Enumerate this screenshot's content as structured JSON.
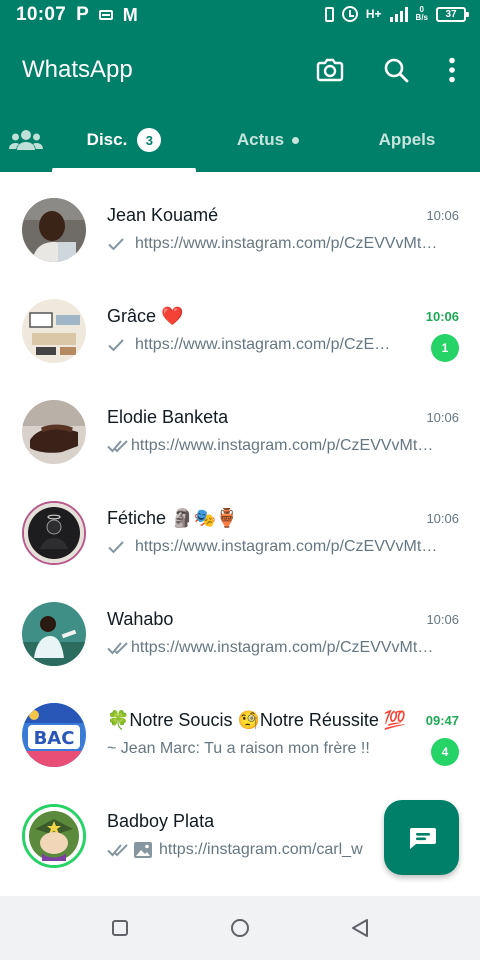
{
  "status_bar": {
    "time": "10:07",
    "icon_p": "P",
    "icon_gmail": "M",
    "data_label": "H+",
    "speed_top": "0",
    "speed_bottom": "B/s",
    "battery": "37"
  },
  "app": {
    "title": "WhatsApp"
  },
  "tabs": {
    "chats_label": "Disc.",
    "chats_badge": "3",
    "status_label": "Actus",
    "calls_label": "Appels"
  },
  "chats": [
    {
      "name": "Jean Kouamé",
      "time": "10:06",
      "preview": "https://www.instagram.com/p/CzEVVvMtWfE/?igshid=",
      "tick": "single",
      "time_unread": false
    },
    {
      "name": "Grâce ❤️",
      "time": "10:06",
      "preview": "https://www.instagram.com/p/CzEVVvMtWfE/?igshid=",
      "tick": "single",
      "time_unread": true,
      "badge": "1"
    },
    {
      "name": "Elodie Banketa",
      "time": "10:06",
      "preview": "https://www.instagram.com/p/CzEVVvMtWfE/?igshid=",
      "tick": "double",
      "time_unread": false
    },
    {
      "name": "Fétiche 🗿🎭🏺",
      "time": "10:06",
      "preview": "https://www.instagram.com/p/CzEVVvMtWfE/?igshid=",
      "tick": "single",
      "time_unread": false
    },
    {
      "name": "Wahabo",
      "time": "10:06",
      "preview": "https://www.instagram.com/p/CzEVVvMtWfE/?igshid=",
      "tick": "double",
      "time_unread": false
    },
    {
      "name": "🍀Notre Soucis 🧐Notre Réussite 💯",
      "time": "09:47",
      "preview": "~ Jean Marc: Tu a raison mon frère !!",
      "tick": "none",
      "time_unread": true,
      "badge": "4"
    },
    {
      "name": "Badboy Plata",
      "time": "",
      "preview": "https://instagram.com/carl_w",
      "tick": "double",
      "time_unread": false
    }
  ],
  "colors": {
    "brand": "#008069",
    "unread_green": "#25d366",
    "secondary_text": "#667781"
  }
}
